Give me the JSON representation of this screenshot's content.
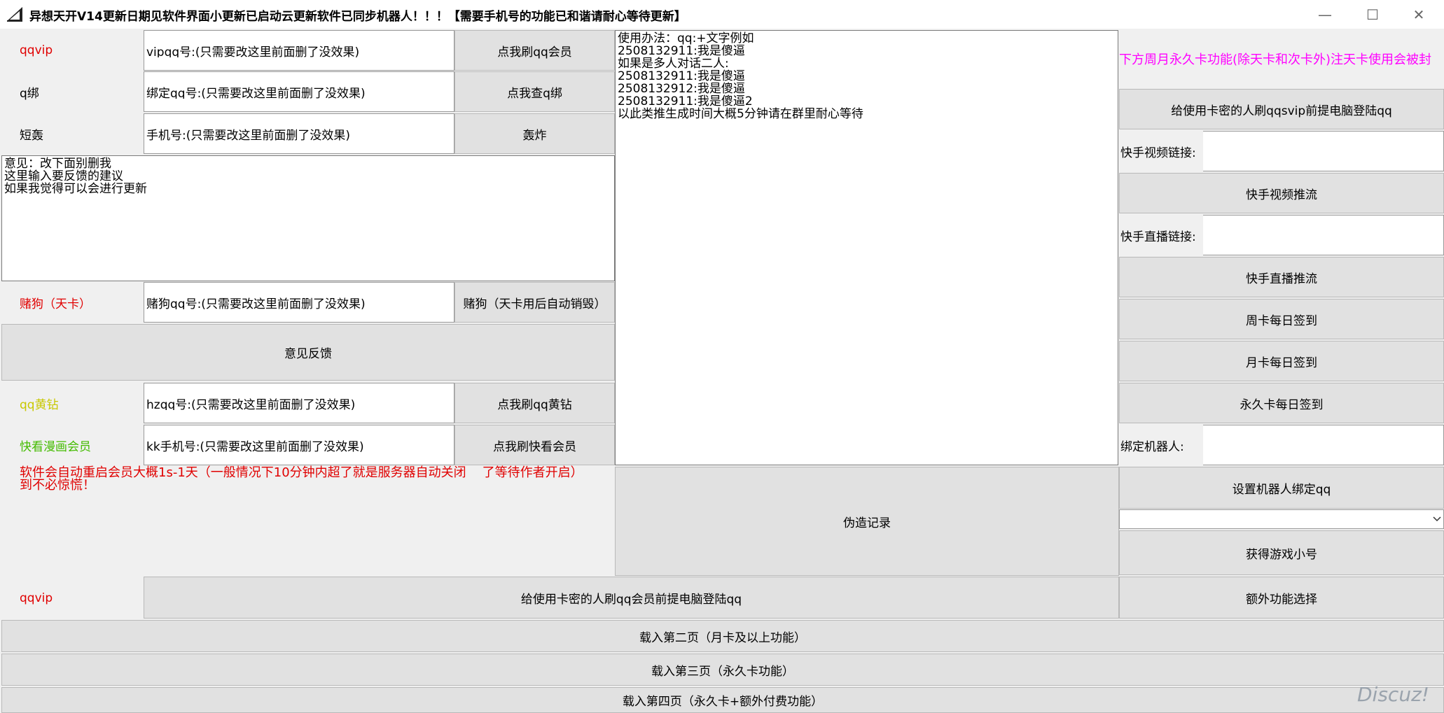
{
  "window": {
    "title": "异想天开V14更新日期见软件界面小更新已启动云更新软件已同步机器人！！！【需要手机号的功能已和谐请耐心等待更新】",
    "minimize_glyph": "—",
    "maximize_glyph": "☐",
    "close_glyph": "✕",
    "app_icon": "app-logo-icon"
  },
  "colors": {
    "red": "#e00000",
    "yellow": "#c8c800",
    "green": "#44bb00",
    "magenta": "#ff00ff"
  },
  "left": {
    "qqvip_label": "qqvip",
    "qqvip_input": "vipqq号:(只需要改这里前面删了没效果)",
    "qqvip_button": "点我刷qq会员",
    "qbind_label": "q绑",
    "qbind_input": "绑定qq号:(只需要改这里前面删了没效果)",
    "qbind_button": "点我查q绑",
    "sms_label": "短轰",
    "sms_input": "手机号:(只需要改这里前面删了没效果)",
    "sms_button": "轰炸",
    "feedback_text": "意见：改下面别删我\n这里输入要反馈的建议\n如果我觉得可以会进行更新",
    "gamble_label": "赌狗（天卡）",
    "gamble_input": "赌狗qq号:(只需要改这里前面删了没效果)",
    "gamble_button": "赌狗（天卡用后自动销毁）",
    "feedback_button": "意见反馈",
    "yellow_label": "qq黄钻",
    "yellow_input": "hzqq号:(只需要改这里前面删了没效果)",
    "yellow_button": "点我刷qq黄钻",
    "kk_label": "快看漫画会员",
    "kk_input": "kk手机号:(只需要改这里前面删了没效果)",
    "kk_button": "点我刷快看会员",
    "notice": "软件会自动重启会员大概1s-1天（一般情况下10分钟内超了就是服务器自动关闭    了等待作者开启）\n到不必惊慌！",
    "qqvip2_label": "qqvip",
    "qqvip2_button": "给使用卡密的人刷qq会员前提电脑登陆qq"
  },
  "middle": {
    "usage_text": "使用办法：qq:+文字例如\n2508132911:我是傻逼\n如果是多人对话二人:\n2508132911:我是傻逼\n2508132912:我是傻逼\n2508132911:我是傻逼2\n以此类推生成时间大概5分钟请在群里耐心等待",
    "forge_button": "伪造记录"
  },
  "right": {
    "notice": "下方周月永久卡功能(除天卡和次卡外)注天卡使用会被封",
    "svip_button": "给使用卡密的人刷qqsvip前提电脑登陆qq",
    "ks_video_label": "快手视频链接:",
    "ks_video_button": "快手视频推流",
    "ks_live_label": "快手直播链接:",
    "ks_live_button": "快手直播推流",
    "weekly_button": "周卡每日签到",
    "monthly_button": "月卡每日签到",
    "forever_button": "永久卡每日签到",
    "bind_robot_label": "绑定机器人:",
    "set_robot_button": "设置机器人绑定qq",
    "combo_value": "",
    "game_button": "获得游戏小号",
    "extra_button": "额外功能选择"
  },
  "bottom": {
    "page2_button": "载入第二页（月卡及以上功能）",
    "page3_button": "载入第三页（永久卡功能）",
    "page4_button": "载入第四页（永久卡+额外付费功能）"
  },
  "watermark": "Discuz!"
}
